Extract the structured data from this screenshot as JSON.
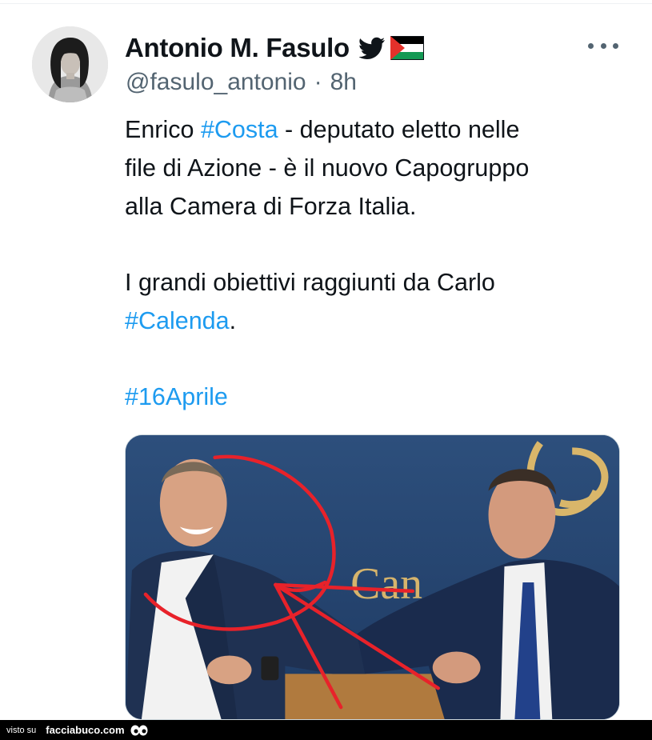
{
  "tweet": {
    "display_name": "Antonio M. Fasulo",
    "handle": "@fasulo_antonio",
    "separator": "·",
    "time": "8h",
    "lines": [
      {
        "parts": [
          {
            "text": "Enrico ",
            "tag": false
          },
          {
            "text": "#Costa",
            "tag": true
          },
          {
            "text": " - deputato eletto nelle",
            "tag": false
          }
        ]
      },
      {
        "parts": [
          {
            "text": "file di Azione - è il nuovo Capogruppo",
            "tag": false
          }
        ]
      },
      {
        "parts": [
          {
            "text": "alla Camera di Forza Italia.",
            "tag": false
          }
        ]
      },
      {
        "spacer": true
      },
      {
        "parts": [
          {
            "text": "I grandi obiettivi raggiunti da Carlo",
            "tag": false
          }
        ]
      },
      {
        "parts": [
          {
            "text": "#Calenda",
            "tag": true
          },
          {
            "text": ".",
            "tag": false
          }
        ]
      },
      {
        "spacer": true
      },
      {
        "parts": [
          {
            "text": "#16Aprile",
            "tag": true
          }
        ]
      }
    ],
    "media": {
      "wall_text": "Can",
      "icons": [
        "annotated-photo-two-men-elbow-bump"
      ]
    },
    "icons": {
      "verified_badge": "twitter-bird-icon",
      "flag": "palestine-flag-icon",
      "menu": "more-options-icon"
    }
  },
  "footer": {
    "prefix": "visto su",
    "site": "facciabuco.com",
    "icon": "eyes-icon"
  },
  "colors": {
    "link": "#1d9bf0",
    "secondary_text": "#536471",
    "primary_text": "#0f1419",
    "annotation_red": "#e8222a"
  }
}
